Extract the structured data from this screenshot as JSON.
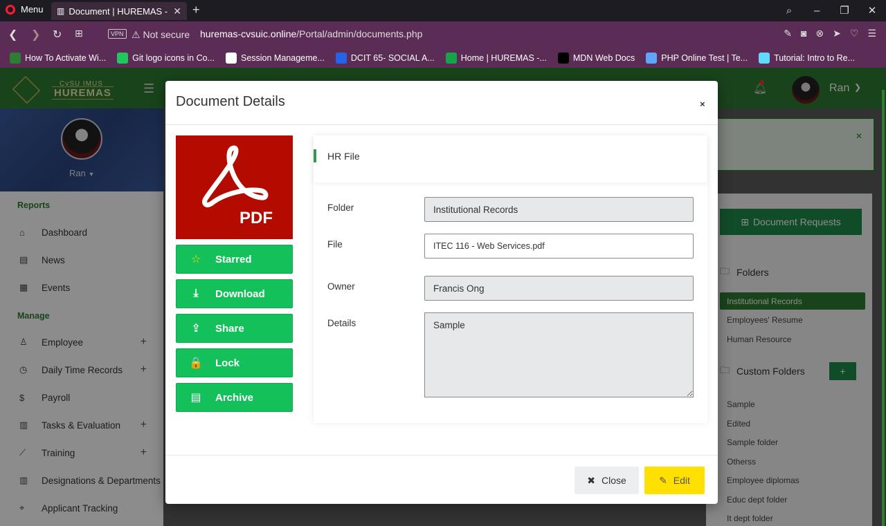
{
  "browser": {
    "menu_label": "Menu",
    "tab_title": "Document | HUREMAS - Cv",
    "url_domain": "huremas-cvsuic.online",
    "url_path": "/Portal/admin/documents.php",
    "security_label": "Not secure",
    "vpn_label": "VPN",
    "bookmarks": [
      {
        "label": "How To Activate Wi...",
        "color": "#2e7d32"
      },
      {
        "label": "Git logo icons in Co...",
        "color": "#22c55e"
      },
      {
        "label": "Session Manageme...",
        "color": "#ffffff"
      },
      {
        "label": "DCIT 65- SOCIAL A...",
        "color": "#2563eb"
      },
      {
        "label": "Home | HUREMAS -...",
        "color": "#16a34a"
      },
      {
        "label": "MDN Web Docs",
        "color": "#000000"
      },
      {
        "label": "PHP Online Test | Te...",
        "color": "#60a5fa"
      },
      {
        "label": "Tutorial: Intro to Re...",
        "color": "#61dafb"
      }
    ]
  },
  "app": {
    "logo_line1": "CvSU IMUS",
    "logo_line2": "HUREMAS",
    "user_name": "Ran"
  },
  "sidebar": {
    "profile_name": "Ran",
    "section_reports": "Reports",
    "section_manage": "Manage",
    "reports_items": [
      {
        "label": "Dashboard",
        "icon": "home-icon"
      },
      {
        "label": "News",
        "icon": "newspaper-icon"
      },
      {
        "label": "Events",
        "icon": "calendar-icon"
      }
    ],
    "manage_items": [
      {
        "label": "Employee",
        "icon": "user-icon",
        "expandable": true
      },
      {
        "label": "Daily Time Records",
        "icon": "clock-icon",
        "expandable": true
      },
      {
        "label": "Payroll",
        "icon": "dollar-icon",
        "expandable": false
      },
      {
        "label": "Tasks & Evaluation",
        "icon": "chart-icon",
        "expandable": true
      },
      {
        "label": "Training",
        "icon": "trend-icon",
        "expandable": true
      },
      {
        "label": "Designations & Departments",
        "icon": "columns-icon",
        "expandable": false
      },
      {
        "label": "Applicant Tracking",
        "icon": "crosshair-icon",
        "expandable": false
      }
    ]
  },
  "right_panel": {
    "requests_button": "Document Requests",
    "folders_heading": "Folders",
    "folders": [
      "Institutional Records",
      "Employees' Resume",
      "Human Resource"
    ],
    "active_folder": "Institutional Records",
    "custom_heading": "Custom Folders",
    "custom_plus": "+",
    "custom_folders": [
      "Sample",
      "Edited",
      "Sample folder",
      "Otherss",
      "Employee diplomas",
      "Educ dept folder",
      "It dept folder"
    ]
  },
  "modal": {
    "title": "Document Details",
    "close_x": "×",
    "pdf_label": "PDF",
    "actions": [
      {
        "label": "Starred",
        "icon": "star-icon",
        "glyph": "☆"
      },
      {
        "label": "Download",
        "icon": "download-icon",
        "glyph": "⤓"
      },
      {
        "label": "Share",
        "icon": "share-icon",
        "glyph": "⇪"
      },
      {
        "label": "Lock",
        "icon": "lock-icon",
        "glyph": "🔒"
      },
      {
        "label": "Archive",
        "icon": "archive-icon",
        "glyph": "▤"
      }
    ],
    "category": "HR File",
    "fields": {
      "folder_label": "Folder",
      "folder_value": "Institutional Records",
      "file_label": "File",
      "file_value": "ITEC 116 - Web Services.pdf",
      "owner_label": "Owner",
      "owner_value": "Francis Ong",
      "details_label": "Details",
      "details_value": "Sample"
    },
    "close_button": "Close",
    "edit_button": "Edit"
  }
}
